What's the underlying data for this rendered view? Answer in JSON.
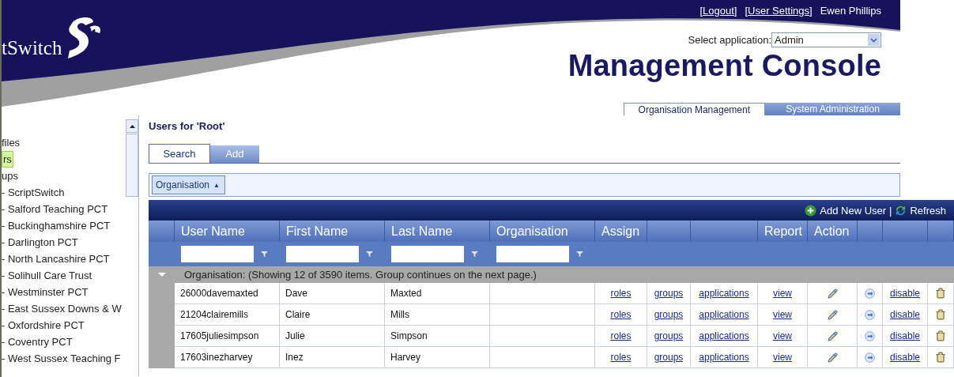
{
  "header": {
    "logo_text": "tSwitch",
    "links": [
      "[Logout]",
      "[User Settings]"
    ],
    "user_name": "Ewen Phillips",
    "app_select": {
      "label": "Select application:",
      "value": "Admin"
    },
    "title": "Management Console"
  },
  "top_tabs": [
    {
      "label": "Organisation Management",
      "selected": true
    },
    {
      "label": "System Administration",
      "selected": false
    }
  ],
  "sidebar": {
    "items": [
      {
        "label": "files",
        "selected": false
      },
      {
        "label": "rs",
        "selected": true
      },
      {
        "label": "ups",
        "selected": false,
        "children": [
          {
            "label": "- ScriptSwitch",
            "selected": false
          },
          {
            "label": "- Salford Teaching PCT",
            "selected": false
          },
          {
            "label": "- Buckinghamshire PCT",
            "selected": false
          },
          {
            "label": "- Darlington PCT",
            "selected": false
          },
          {
            "label": "- North Lancashire PCT",
            "selected": false
          },
          {
            "label": "- Solihull Care Trust",
            "selected": false
          },
          {
            "label": "- Westminster PCT",
            "selected": false
          },
          {
            "label": "- East Sussex Downs & W",
            "selected": false
          },
          {
            "label": "- Oxfordshire PCT",
            "selected": false
          },
          {
            "label": "- Coventry PCT",
            "selected": false
          },
          {
            "label": "- West Sussex Teaching F",
            "selected": false
          }
        ]
      }
    ]
  },
  "page_title": "Users for 'Root'",
  "tabs": [
    {
      "label": "Search",
      "selected": true
    },
    {
      "label": "Add",
      "selected": false
    }
  ],
  "group_panel": {
    "chip": "Organisation",
    "sort_glyph": "▲"
  },
  "grid": {
    "toolbar": {
      "add_label": "Add New User",
      "separator": "|",
      "refresh_label": "Refresh"
    },
    "columns": [
      {
        "label": "User Name",
        "filter": true
      },
      {
        "label": "First Name",
        "filter": true
      },
      {
        "label": "Last Name",
        "filter": true
      },
      {
        "label": "Organisation",
        "filter": true
      },
      {
        "label": "Assign",
        "filter": false
      },
      {
        "filter": false
      },
      {
        "filter": false
      },
      {
        "label": "Report",
        "filter": false
      },
      {
        "label": "Action",
        "filter": false
      },
      {
        "filter": false
      },
      {
        "filter": false
      },
      {
        "filter": false
      }
    ],
    "group": {
      "label": "Organisation: (Showing 12 of 3590 items. Group continues on the next page.)",
      "expanded": true
    },
    "rows": [
      {
        "user_name": "26000davemaxted",
        "first_name": "Dave",
        "last_name": "Maxted",
        "roles": "roles",
        "groups": "groups",
        "applications": "applications",
        "report": "view",
        "disable": "disable"
      },
      {
        "user_name": "21204clairemills",
        "first_name": "Claire",
        "last_name": "Mills",
        "roles": "roles",
        "groups": "groups",
        "applications": "applications",
        "report": "view",
        "disable": "disable"
      },
      {
        "user_name": "17605juliesimpson",
        "first_name": "Julie",
        "last_name": "Simpson",
        "roles": "roles",
        "groups": "groups",
        "applications": "applications",
        "report": "view",
        "disable": "disable"
      },
      {
        "user_name": "17603inezharvey",
        "first_name": "Inez",
        "last_name": "Harvey",
        "roles": "roles",
        "groups": "groups",
        "applications": "applications",
        "report": "view",
        "disable": "disable"
      }
    ]
  }
}
